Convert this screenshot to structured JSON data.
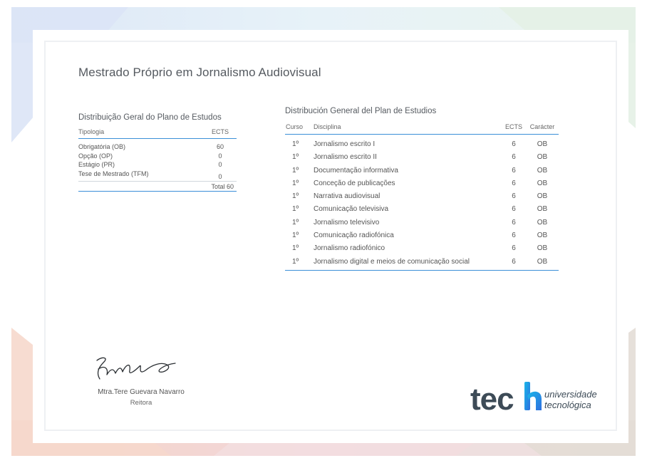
{
  "page": {
    "title": "Mestrado Próprio em Jornalismo Audiovisual"
  },
  "left_table": {
    "title": "Distribuição Geral do Plano de Estudos",
    "headers": {
      "tipologia": "Tipologia",
      "ects": "ECTS"
    },
    "rows": [
      {
        "tipologia": "Obrigatória (OB)",
        "ects": "60"
      },
      {
        "tipologia": "Opção (OP)",
        "ects": "0"
      },
      {
        "tipologia": "Estágio (PR)",
        "ects": "0"
      },
      {
        "tipologia": "Tese de Mestrado (TFM)",
        "ects": "0"
      }
    ],
    "total": "Total 60"
  },
  "right_table": {
    "title": "Distribución General del Plan de Estudios",
    "headers": {
      "curso": "Curso",
      "disciplina": "Disciplina",
      "ects": "ECTS",
      "caracter": "Carácter"
    },
    "rows": [
      {
        "curso": "1º",
        "disciplina": "Jornalismo escrito I",
        "ects": "6",
        "caracter": "OB"
      },
      {
        "curso": "1º",
        "disciplina": "Jornalismo escrito II",
        "ects": "6",
        "caracter": "OB"
      },
      {
        "curso": "1º",
        "disciplina": "Documentação informativa",
        "ects": "6",
        "caracter": "OB"
      },
      {
        "curso": "1º",
        "disciplina": "Conceção de publicações",
        "ects": "6",
        "caracter": "OB"
      },
      {
        "curso": "1º",
        "disciplina": "Narrativa audiovisual",
        "ects": "6",
        "caracter": "OB"
      },
      {
        "curso": "1º",
        "disciplina": "Comunicação televisiva",
        "ects": "6",
        "caracter": "OB"
      },
      {
        "curso": "1º",
        "disciplina": "Jornalismo televisivo",
        "ects": "6",
        "caracter": "OB"
      },
      {
        "curso": "1º",
        "disciplina": "Comunicação radiofónica",
        "ects": "6",
        "caracter": "OB"
      },
      {
        "curso": "1º",
        "disciplina": "Jornalismo radiofónico",
        "ects": "6",
        "caracter": "OB"
      },
      {
        "curso": "1º",
        "disciplina": "Jornalismo digital e meios de comunicação social",
        "ects": "6",
        "caracter": "OB"
      }
    ]
  },
  "signatory": {
    "name": "Mtra.Tere Guevara Navarro",
    "role": "Reitora",
    "icon": "signature-icon"
  },
  "logo": {
    "wordmark": "tech",
    "tagline_1": "universidade",
    "tagline_2": "tecnológica",
    "icon": "tech-logo-icon"
  },
  "colors": {
    "accent_blue": "#3a8fd8",
    "logo_dark": "#3d4b57",
    "logo_gradient_start": "#19b6e8",
    "logo_gradient_end": "#2f6fe0"
  }
}
